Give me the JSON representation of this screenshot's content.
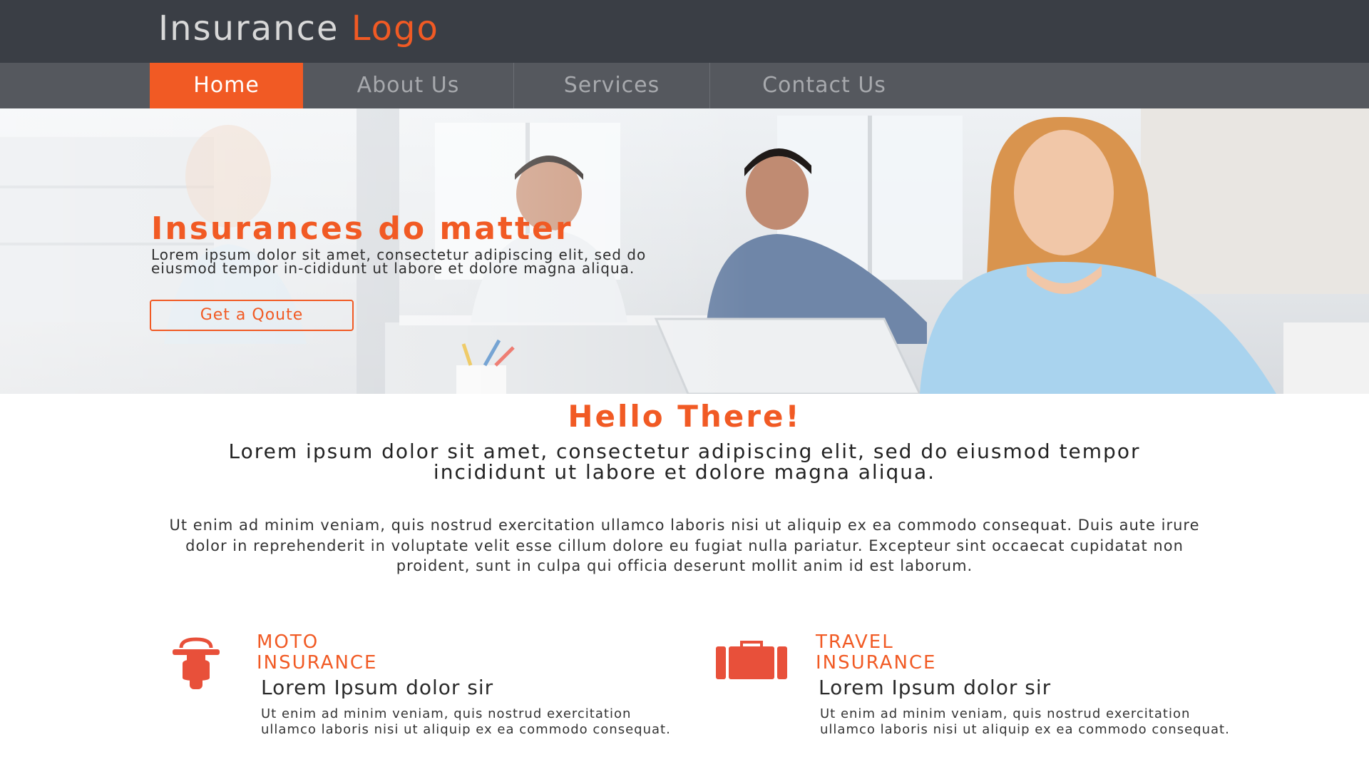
{
  "header": {
    "logo_word1": "Insurance",
    "logo_word2": "Logo"
  },
  "nav": {
    "items": [
      {
        "label": "Home",
        "active": true
      },
      {
        "label": "About Us",
        "active": false
      },
      {
        "label": "Services",
        "active": false
      },
      {
        "label": "Contact Us",
        "active": false
      }
    ]
  },
  "hero": {
    "title": "Insurances do matter",
    "text": "Lorem ipsum dolor sit amet, consectetur adipiscing elit, sed do eiusmod tempor in-cididunt ut labore et dolore magna aliqua.",
    "button_label": "Get a Qoute"
  },
  "intro": {
    "heading": "Hello There!",
    "lead": "Lorem ipsum dolor sit amet, consectetur adipiscing elit, sed do eiusmod tempor incididunt ut labore et dolore magna aliqua.",
    "body": "Ut enim ad minim veniam, quis nostrud exercitation ullamco laboris nisi ut aliquip ex ea commodo consequat. Duis aute irure dolor in reprehenderit in voluptate velit esse cillum dolore eu fugiat nulla pariatur. Excepteur sint occaecat cupidatat non proident, sunt in culpa qui officia deserunt mollit anim id est laborum."
  },
  "features": [
    {
      "icon": "scooter-icon",
      "title_line1": "MOTO",
      "title_line2": "INSURANCE",
      "subtitle": "Lorem Ipsum dolor sir",
      "text": "Ut enim ad minim veniam, quis nostrud exercitation ullamco laboris nisi ut aliquip ex ea commodo consequat."
    },
    {
      "icon": "suitcase-icon",
      "title_line1": "TRAVEL",
      "title_line2": "INSURANCE",
      "subtitle": "Lorem Ipsum dolor sir",
      "text": "Ut enim ad minim veniam, quis nostrud exercitation ullamco laboris nisi ut aliquip ex ea commodo consequat."
    }
  ],
  "colors": {
    "accent": "#f15a24",
    "header_bg": "#3a3e45",
    "nav_bg": "#55585e"
  }
}
